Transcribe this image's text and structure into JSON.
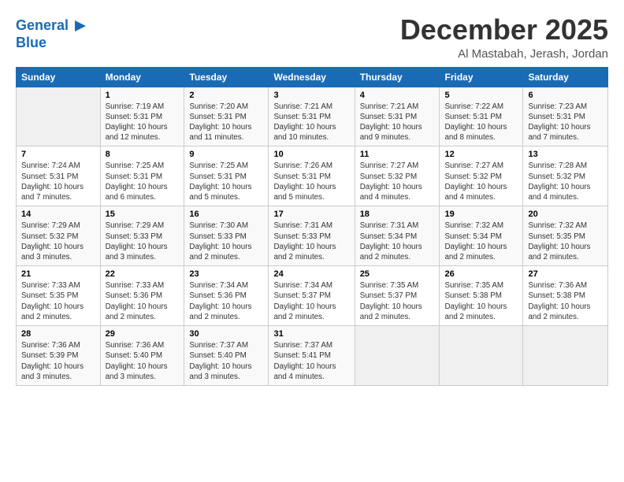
{
  "logo": {
    "line1": "General",
    "line2": "Blue",
    "arrow_color": "#1a6bb5"
  },
  "title": "December 2025",
  "location": "Al Mastabah, Jerash, Jordan",
  "days_of_week": [
    "Sunday",
    "Monday",
    "Tuesday",
    "Wednesday",
    "Thursday",
    "Friday",
    "Saturday"
  ],
  "weeks": [
    [
      {
        "day": "",
        "detail": ""
      },
      {
        "day": "1",
        "detail": "Sunrise: 7:19 AM\nSunset: 5:31 PM\nDaylight: 10 hours\nand 12 minutes."
      },
      {
        "day": "2",
        "detail": "Sunrise: 7:20 AM\nSunset: 5:31 PM\nDaylight: 10 hours\nand 11 minutes."
      },
      {
        "day": "3",
        "detail": "Sunrise: 7:21 AM\nSunset: 5:31 PM\nDaylight: 10 hours\nand 10 minutes."
      },
      {
        "day": "4",
        "detail": "Sunrise: 7:21 AM\nSunset: 5:31 PM\nDaylight: 10 hours\nand 9 minutes."
      },
      {
        "day": "5",
        "detail": "Sunrise: 7:22 AM\nSunset: 5:31 PM\nDaylight: 10 hours\nand 8 minutes."
      },
      {
        "day": "6",
        "detail": "Sunrise: 7:23 AM\nSunset: 5:31 PM\nDaylight: 10 hours\nand 7 minutes."
      }
    ],
    [
      {
        "day": "7",
        "detail": "Sunrise: 7:24 AM\nSunset: 5:31 PM\nDaylight: 10 hours\nand 7 minutes."
      },
      {
        "day": "8",
        "detail": "Sunrise: 7:25 AM\nSunset: 5:31 PM\nDaylight: 10 hours\nand 6 minutes."
      },
      {
        "day": "9",
        "detail": "Sunrise: 7:25 AM\nSunset: 5:31 PM\nDaylight: 10 hours\nand 5 minutes."
      },
      {
        "day": "10",
        "detail": "Sunrise: 7:26 AM\nSunset: 5:31 PM\nDaylight: 10 hours\nand 5 minutes."
      },
      {
        "day": "11",
        "detail": "Sunrise: 7:27 AM\nSunset: 5:32 PM\nDaylight: 10 hours\nand 4 minutes."
      },
      {
        "day": "12",
        "detail": "Sunrise: 7:27 AM\nSunset: 5:32 PM\nDaylight: 10 hours\nand 4 minutes."
      },
      {
        "day": "13",
        "detail": "Sunrise: 7:28 AM\nSunset: 5:32 PM\nDaylight: 10 hours\nand 4 minutes."
      }
    ],
    [
      {
        "day": "14",
        "detail": "Sunrise: 7:29 AM\nSunset: 5:32 PM\nDaylight: 10 hours\nand 3 minutes."
      },
      {
        "day": "15",
        "detail": "Sunrise: 7:29 AM\nSunset: 5:33 PM\nDaylight: 10 hours\nand 3 minutes."
      },
      {
        "day": "16",
        "detail": "Sunrise: 7:30 AM\nSunset: 5:33 PM\nDaylight: 10 hours\nand 2 minutes."
      },
      {
        "day": "17",
        "detail": "Sunrise: 7:31 AM\nSunset: 5:33 PM\nDaylight: 10 hours\nand 2 minutes."
      },
      {
        "day": "18",
        "detail": "Sunrise: 7:31 AM\nSunset: 5:34 PM\nDaylight: 10 hours\nand 2 minutes."
      },
      {
        "day": "19",
        "detail": "Sunrise: 7:32 AM\nSunset: 5:34 PM\nDaylight: 10 hours\nand 2 minutes."
      },
      {
        "day": "20",
        "detail": "Sunrise: 7:32 AM\nSunset: 5:35 PM\nDaylight: 10 hours\nand 2 minutes."
      }
    ],
    [
      {
        "day": "21",
        "detail": "Sunrise: 7:33 AM\nSunset: 5:35 PM\nDaylight: 10 hours\nand 2 minutes."
      },
      {
        "day": "22",
        "detail": "Sunrise: 7:33 AM\nSunset: 5:36 PM\nDaylight: 10 hours\nand 2 minutes."
      },
      {
        "day": "23",
        "detail": "Sunrise: 7:34 AM\nSunset: 5:36 PM\nDaylight: 10 hours\nand 2 minutes."
      },
      {
        "day": "24",
        "detail": "Sunrise: 7:34 AM\nSunset: 5:37 PM\nDaylight: 10 hours\nand 2 minutes."
      },
      {
        "day": "25",
        "detail": "Sunrise: 7:35 AM\nSunset: 5:37 PM\nDaylight: 10 hours\nand 2 minutes."
      },
      {
        "day": "26",
        "detail": "Sunrise: 7:35 AM\nSunset: 5:38 PM\nDaylight: 10 hours\nand 2 minutes."
      },
      {
        "day": "27",
        "detail": "Sunrise: 7:36 AM\nSunset: 5:38 PM\nDaylight: 10 hours\nand 2 minutes."
      }
    ],
    [
      {
        "day": "28",
        "detail": "Sunrise: 7:36 AM\nSunset: 5:39 PM\nDaylight: 10 hours\nand 3 minutes."
      },
      {
        "day": "29",
        "detail": "Sunrise: 7:36 AM\nSunset: 5:40 PM\nDaylight: 10 hours\nand 3 minutes."
      },
      {
        "day": "30",
        "detail": "Sunrise: 7:37 AM\nSunset: 5:40 PM\nDaylight: 10 hours\nand 3 minutes."
      },
      {
        "day": "31",
        "detail": "Sunrise: 7:37 AM\nSunset: 5:41 PM\nDaylight: 10 hours\nand 4 minutes."
      },
      {
        "day": "",
        "detail": ""
      },
      {
        "day": "",
        "detail": ""
      },
      {
        "day": "",
        "detail": ""
      }
    ]
  ]
}
